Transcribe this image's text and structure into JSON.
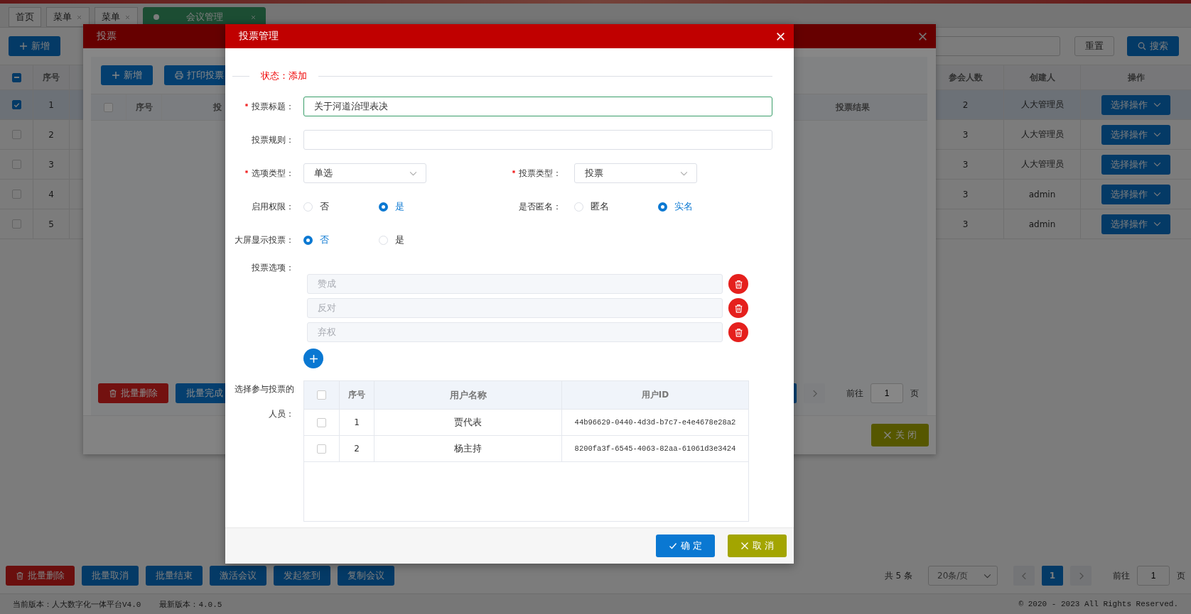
{
  "tabs": [
    {
      "label": "首页",
      "closable": false,
      "selected": false
    },
    {
      "label": "菜单",
      "closable": true,
      "selected": false
    },
    {
      "label": "菜单",
      "closable": true,
      "selected": false
    },
    {
      "label": "会议管理",
      "closable": true,
      "selected": true
    }
  ],
  "toolbar": {
    "add_button": "新增",
    "reset_button": "重置",
    "search_button": "搜索"
  },
  "meetings_table": {
    "header_indeterminate": true,
    "columns": [
      "序号",
      "参会人数",
      "创建人",
      "操作"
    ],
    "rows": [
      {
        "index": "1",
        "attendees": "2",
        "creator": "人大管理员",
        "action": "选择操作",
        "checked": true,
        "selected": true
      },
      {
        "index": "2",
        "attendees": "3",
        "creator": "人大管理员",
        "action": "选择操作",
        "checked": false,
        "selected": false
      },
      {
        "index": "3",
        "attendees": "3",
        "creator": "人大管理员",
        "action": "选择操作",
        "checked": false,
        "selected": false
      },
      {
        "index": "4",
        "attendees": "3",
        "creator": "admin",
        "action": "选择操作",
        "checked": false,
        "selected": false
      },
      {
        "index": "5",
        "attendees": "3",
        "creator": "admin",
        "action": "选择操作",
        "checked": false,
        "selected": false
      }
    ]
  },
  "bulk_actions": [
    {
      "label": "批量删除",
      "kind": "danger"
    },
    {
      "label": "批量取消",
      "kind": "primary"
    },
    {
      "label": "批量结束",
      "kind": "primary"
    },
    {
      "label": "激活会议",
      "kind": "primary"
    },
    {
      "label": "发起签到",
      "kind": "primary"
    },
    {
      "label": "复制会议",
      "kind": "primary"
    }
  ],
  "pagination": {
    "total": "共 5 条",
    "page_size": "20条/页",
    "pages": [
      {
        "label": "1",
        "selected": true
      }
    ],
    "goto_label": "前往",
    "goto_value": "1",
    "page_unit": "页"
  },
  "footer": {
    "current_version": "当前版本：人大数字化一体平台V4.0",
    "latest_version": "最新版本：4.0.5",
    "copyright": "© 2020 - 2023 All Rights Reserved."
  },
  "vote_dialog": {
    "title": "投票",
    "toolbar": [
      {
        "label": "新增"
      },
      {
        "label": "打印投票"
      }
    ],
    "header_checked": false,
    "columns": [
      "序号",
      "投",
      "投票结果"
    ],
    "bulk_actions": [
      {
        "label": "批量删除",
        "kind": "danger"
      },
      {
        "label": "批量完成",
        "kind": "primary"
      }
    ],
    "pagination": {
      "goto_label": "前往",
      "goto_value": "1",
      "page_unit": "页"
    },
    "close_button": "关 闭"
  },
  "modal": {
    "title": "投票管理",
    "status": "状态：添加",
    "title_field": {
      "label": "投票标题：",
      "required": true,
      "value": "关于河道治理表决"
    },
    "rule_field": {
      "label": "投票规则：",
      "required": false
    },
    "selects": [
      {
        "label": "选项类型：",
        "required": true,
        "value": "单选"
      },
      {
        "label": "投票类型：",
        "required": true,
        "value": "投票"
      }
    ],
    "radio_groups": [
      {
        "label": "启用权限：",
        "options": [
          {
            "label": "否",
            "selected": false
          },
          {
            "label": "是",
            "selected": true
          }
        ]
      },
      {
        "label": "是否匿名：",
        "options": [
          {
            "label": "匿名",
            "selected": false
          },
          {
            "label": "实名",
            "selected": true
          }
        ]
      },
      {
        "label": "大屏显示投票：",
        "options": [
          {
            "label": "否",
            "selected": true
          },
          {
            "label": "是",
            "selected": false
          }
        ]
      }
    ],
    "vote_options": {
      "label": "投票选项：",
      "items": [
        {
          "value": "赞成",
          "disabled": true
        },
        {
          "value": "反对",
          "disabled": true
        },
        {
          "value": "弃权",
          "disabled": true
        }
      ]
    },
    "participants": {
      "label": "选择参与投票的人员：",
      "header_checked": false,
      "columns": [
        "序号",
        "用户名称",
        "用户ID"
      ],
      "rows": [
        {
          "index": "1",
          "name": "贾代表",
          "id": "44b96629-0440-4d3d-b7c7-e4e4678e28a2",
          "checked": false
        },
        {
          "index": "2",
          "name": "杨主持",
          "id": "8200fa3f-6545-4063-82aa-61061d3e3424",
          "checked": false
        }
      ]
    },
    "confirm_button": "确 定",
    "cancel_button": "取 消"
  }
}
